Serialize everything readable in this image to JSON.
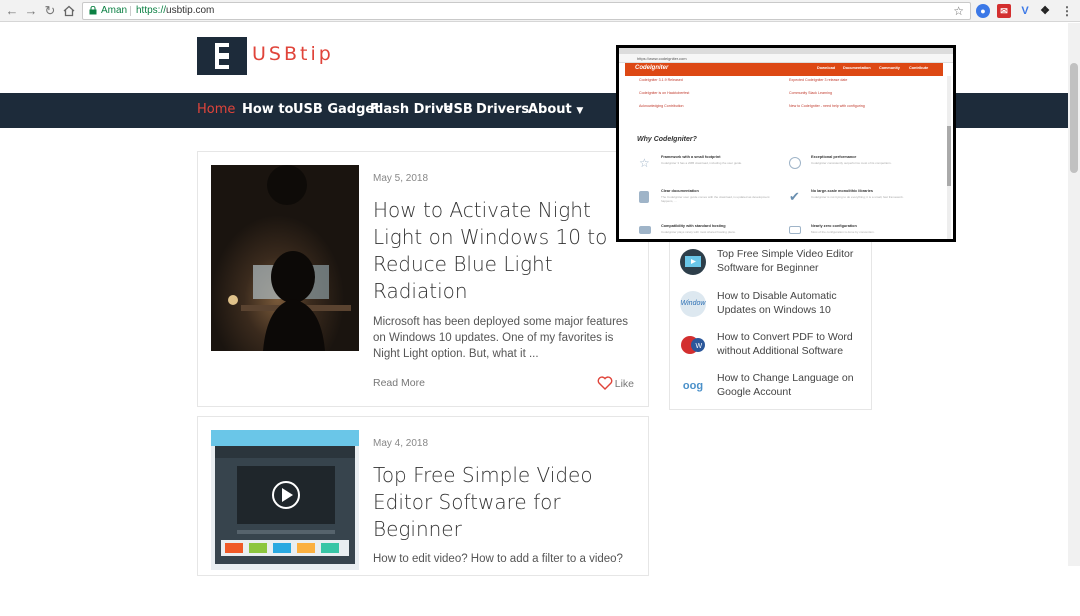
{
  "browser": {
    "site_name": "Aman",
    "url_protocol": "https://",
    "url_host": "usbtip.com"
  },
  "site": {
    "logo_text": "USBtip",
    "nav": [
      "Home",
      "How to",
      "USB Gadget",
      "Flash Drive",
      "USB",
      "Drivers",
      "About"
    ],
    "accent_color": "#e0443a",
    "nav_bg_color": "#1d2b3a"
  },
  "posts": [
    {
      "date": "May 5, 2018",
      "title": "How to Activate Night Light on Windows 10 to Reduce Blue Light Radiation",
      "excerpt": "Microsoft has been deployed some major features on Windows 10 updates. One of my favorites is Night Light option. But, what it ...",
      "read_more": "Read More",
      "like": "Like"
    },
    {
      "date": "May 4, 2018",
      "title": "Top Free Simple Video Editor Software for Beginner",
      "excerpt": "How to edit video? How to add a filter to a video?"
    }
  ],
  "sidebar": {
    "items": [
      {
        "title": "Top Free Simple Video Editor Software for Beginner",
        "icon": "video-editor-icon"
      },
      {
        "title": "How to Disable Automatic Updates on Windows 10",
        "icon": "windows-icon"
      },
      {
        "title": "How to Convert PDF to Word without Additional Software",
        "icon": "pdf-word-icon"
      },
      {
        "title": "How to Change Language on Google Account",
        "icon": "google-icon"
      }
    ]
  },
  "popup": {
    "url": "https://www.codeigniter.com",
    "logo": "CodeIgniter",
    "nav": [
      "Download",
      "Documentation",
      "Community",
      "Contribute"
    ],
    "why": "Why CodeIgniter?",
    "news_left": [
      "CodeIgniter 3.1.9 Released",
      "CodeIgniter is on Hacktoberfest",
      "Acknowledging Contribution"
    ],
    "news_right": [
      "Expected CodeIgniter 3 release date",
      "Community Slack Learning",
      "New to CodeIgniter - need help with configuring"
    ],
    "features": [
      {
        "title": "Framework with a small footprint",
        "desc": "CodeIgniter 3 has a 2MB download, including the user guide.",
        "icon": "star-icon"
      },
      {
        "title": "Exceptional performance",
        "desc": "CodeIgniter consistently outperforms most of its competitors.",
        "icon": "clock-icon"
      },
      {
        "title": "Clear documentation",
        "desc": "The CodeIgniter user guide comes with the download, is updated as development happens, ...",
        "icon": "doc-icon"
      },
      {
        "title": "No large-scale monolithic libraries",
        "desc": "CodeIgniter is not trying to do everything; it is a small, fast framework.",
        "icon": "check-icon"
      },
      {
        "title": "Compatibility with standard hosting",
        "desc": "CodeIgniter plays nicely with most shared hosting plans.",
        "icon": "server-icon"
      },
      {
        "title": "Nearly zero configuration",
        "desc": "Most of the configuration is done by convention.",
        "icon": "gear-icon"
      }
    ]
  }
}
